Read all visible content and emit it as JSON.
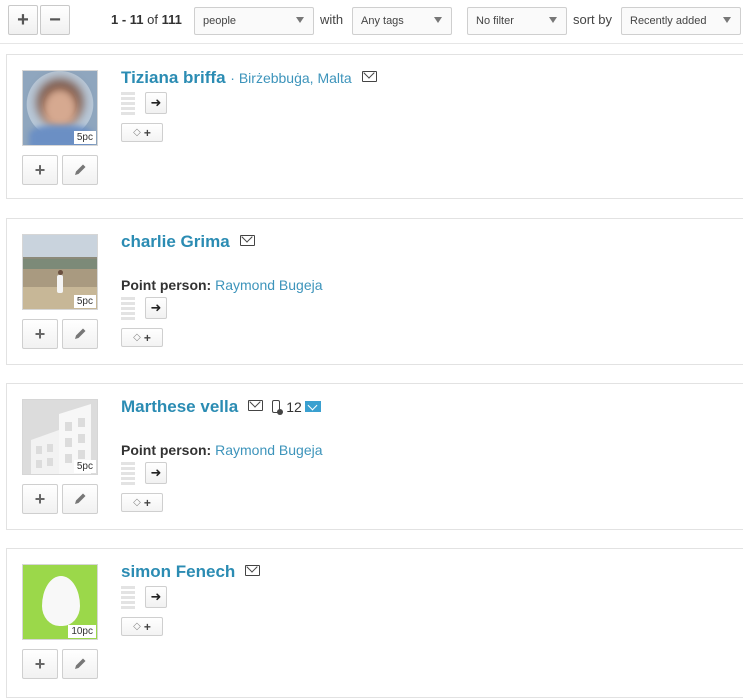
{
  "toolbar": {
    "add_label": "+",
    "remove_label": "−",
    "range": "1 - 11",
    "of_word": "of",
    "total": "111",
    "type_select": "people",
    "with_label": "with",
    "tags_select": "Any tags",
    "filter_select": "No filter",
    "sortby_label": "sort by",
    "sort_select": "Recently added"
  },
  "people": [
    {
      "name": "Tiziana briffa",
      "location": "· Birżebbuġa, Malta",
      "pc": "5pc",
      "point_label": "",
      "point_person": ""
    },
    {
      "name": "charlie Grima",
      "location": "",
      "pc": "5pc",
      "point_label": "Point person:",
      "point_person": "Raymond Bugeja"
    },
    {
      "name": "Marthese vella",
      "location": "",
      "pc": "5pc",
      "count": "12",
      "point_label": "Point person:",
      "point_person": "Raymond Bugeja"
    },
    {
      "name": "simon Fenech",
      "location": "",
      "pc": "10pc",
      "point_label": "",
      "point_person": ""
    }
  ],
  "icons": {
    "add": "plus-icon",
    "edit": "pencil-icon",
    "mail": "mail-icon",
    "share": "share-arrow-icon",
    "tag": "tag-icon",
    "phone": "phone-icon"
  },
  "colors": {
    "link": "#2b8cb3",
    "avatar_green": "#9bd84a"
  }
}
